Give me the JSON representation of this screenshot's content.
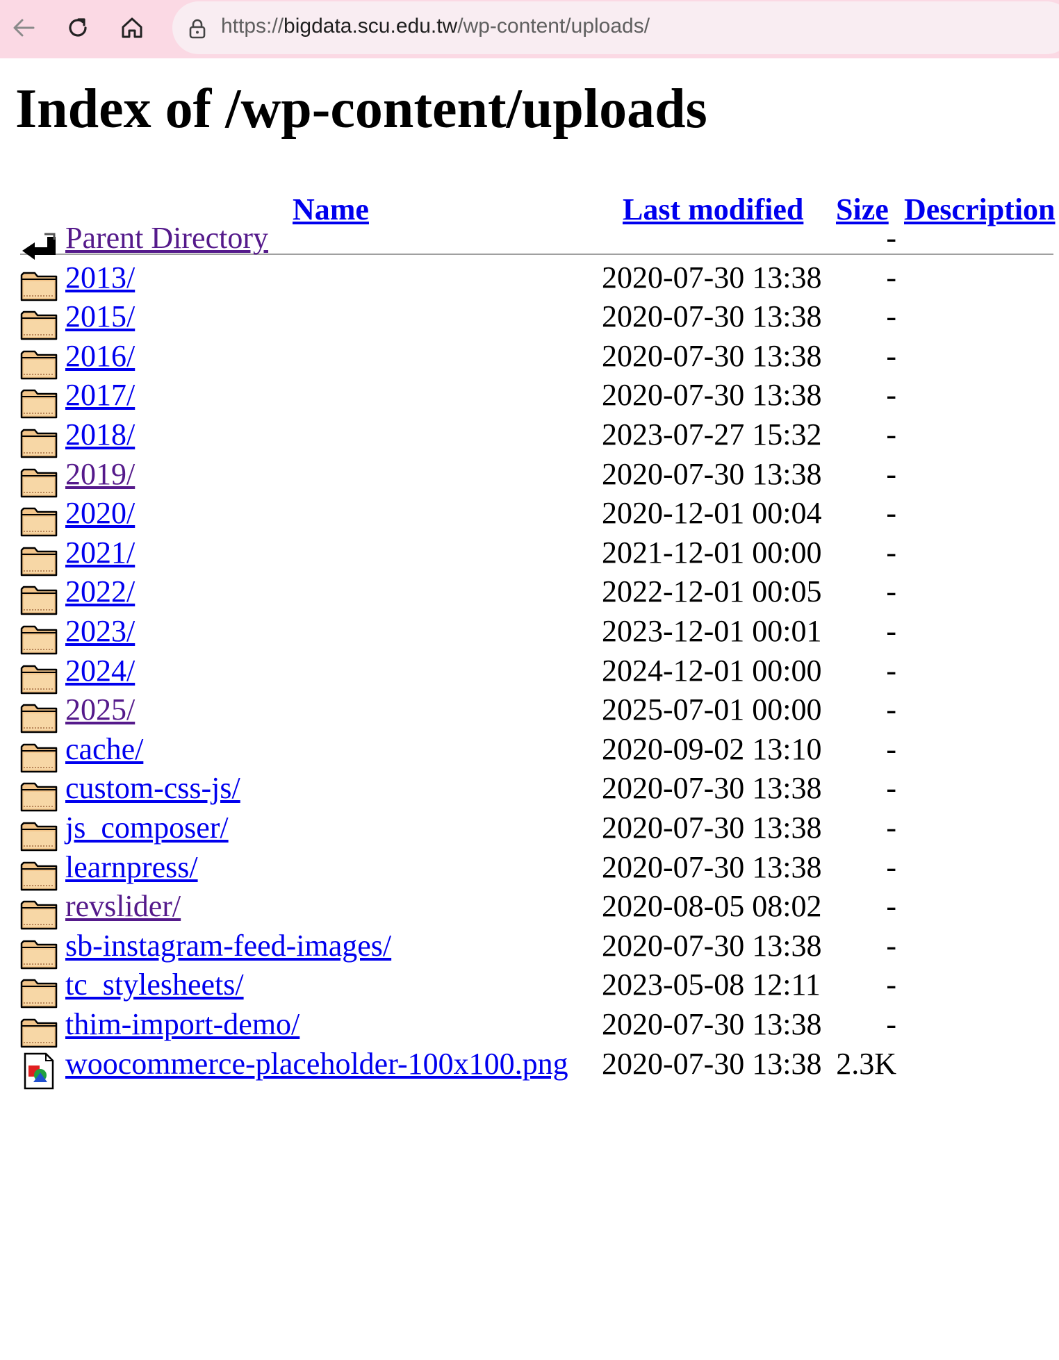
{
  "browser": {
    "url_scheme": "https://",
    "url_host": "bigdata.scu.edu.tw",
    "url_path": "/wp-content/uploads/"
  },
  "page": {
    "title": "Index of /wp-content/uploads",
    "columns": {
      "name": "Name",
      "modified": "Last modified",
      "size": "Size",
      "description": "Description"
    }
  },
  "rows": [
    {
      "name": "Parent Directory",
      "modified": "",
      "size": "-",
      "icon": "back-icon",
      "visited": true
    },
    {
      "name": "2013/",
      "modified": "2020-07-30 13:38",
      "size": "-",
      "icon": "folder-icon",
      "visited": false
    },
    {
      "name": "2015/",
      "modified": "2020-07-30 13:38",
      "size": "-",
      "icon": "folder-icon",
      "visited": false
    },
    {
      "name": "2016/",
      "modified": "2020-07-30 13:38",
      "size": "-",
      "icon": "folder-icon",
      "visited": false
    },
    {
      "name": "2017/",
      "modified": "2020-07-30 13:38",
      "size": "-",
      "icon": "folder-icon",
      "visited": false
    },
    {
      "name": "2018/",
      "modified": "2023-07-27 15:32",
      "size": "-",
      "icon": "folder-icon",
      "visited": false
    },
    {
      "name": "2019/",
      "modified": "2020-07-30 13:38",
      "size": "-",
      "icon": "folder-icon",
      "visited": true
    },
    {
      "name": "2020/",
      "modified": "2020-12-01 00:04",
      "size": "-",
      "icon": "folder-icon",
      "visited": false
    },
    {
      "name": "2021/",
      "modified": "2021-12-01 00:00",
      "size": "-",
      "icon": "folder-icon",
      "visited": false
    },
    {
      "name": "2022/",
      "modified": "2022-12-01 00:05",
      "size": "-",
      "icon": "folder-icon",
      "visited": false
    },
    {
      "name": "2023/",
      "modified": "2023-12-01 00:01",
      "size": "-",
      "icon": "folder-icon",
      "visited": false
    },
    {
      "name": "2024/",
      "modified": "2024-12-01 00:00",
      "size": "-",
      "icon": "folder-icon",
      "visited": false
    },
    {
      "name": "2025/",
      "modified": "2025-07-01 00:00",
      "size": "-",
      "icon": "folder-icon",
      "visited": true
    },
    {
      "name": "cache/",
      "modified": "2020-09-02 13:10",
      "size": "-",
      "icon": "folder-icon",
      "visited": false
    },
    {
      "name": "custom-css-js/",
      "modified": "2020-07-30 13:38",
      "size": "-",
      "icon": "folder-icon",
      "visited": false
    },
    {
      "name": "js_composer/",
      "modified": "2020-07-30 13:38",
      "size": "-",
      "icon": "folder-icon",
      "visited": false
    },
    {
      "name": "learnpress/",
      "modified": "2020-07-30 13:38",
      "size": "-",
      "icon": "folder-icon",
      "visited": false
    },
    {
      "name": "revslider/",
      "modified": "2020-08-05 08:02",
      "size": "-",
      "icon": "folder-icon",
      "visited": true
    },
    {
      "name": "sb-instagram-feed-images/",
      "modified": "2020-07-30 13:38",
      "size": "-",
      "icon": "folder-icon",
      "visited": false
    },
    {
      "name": "tc_stylesheets/",
      "modified": "2023-05-08 12:11",
      "size": "-",
      "icon": "folder-icon",
      "visited": false
    },
    {
      "name": "thim-import-demo/",
      "modified": "2020-07-30 13:38",
      "size": "-",
      "icon": "folder-icon",
      "visited": false
    },
    {
      "name": "woocommerce-placeholder-100x100.png",
      "modified": "2020-07-30 13:38",
      "size": "2.3K",
      "icon": "image-file-icon",
      "visited": false
    }
  ]
}
